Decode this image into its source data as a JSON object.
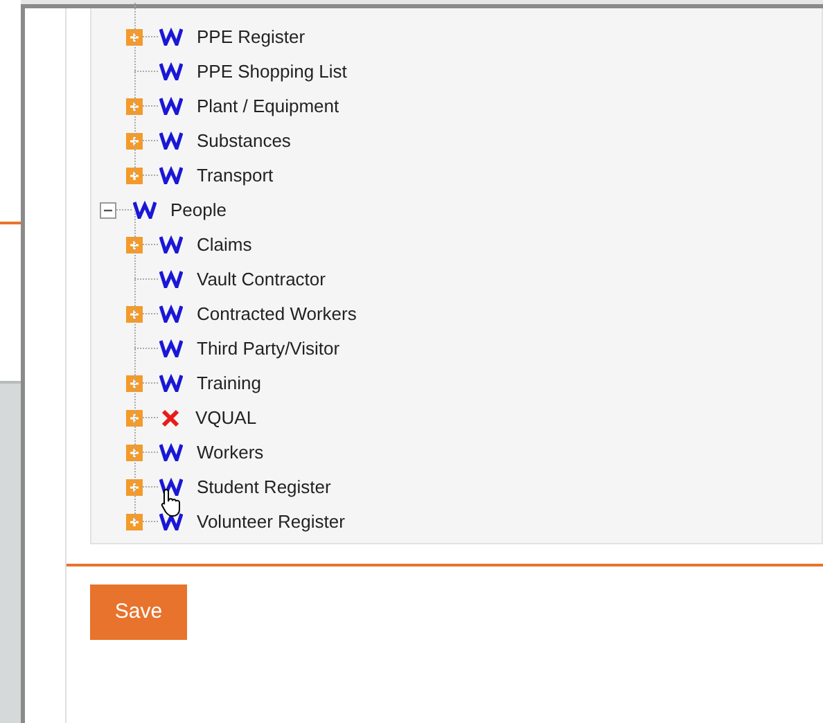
{
  "tree": [
    {
      "children": [
        {
          "label": "PPE Register",
          "kind": "collapsed",
          "error": false
        },
        {
          "label": "PPE Shopping List",
          "kind": "leaf",
          "error": false
        },
        {
          "label": "Plant / Equipment",
          "kind": "collapsed",
          "error": false
        },
        {
          "label": "Substances",
          "kind": "collapsed",
          "error": false
        },
        {
          "label": "Transport",
          "kind": "collapsed",
          "error": false
        }
      ]
    },
    {
      "label": "People",
      "kind": "expanded",
      "error": false,
      "children": [
        {
          "label": "Claims",
          "kind": "collapsed",
          "error": false
        },
        {
          "label": "Vault Contractor",
          "kind": "leaf",
          "error": false
        },
        {
          "label": "Contracted Workers",
          "kind": "collapsed",
          "error": false
        },
        {
          "label": "Third Party/Visitor",
          "kind": "leaf",
          "error": false
        },
        {
          "label": "Training",
          "kind": "collapsed",
          "error": false
        },
        {
          "label": "VQUAL",
          "kind": "collapsed",
          "error": true
        },
        {
          "label": "Workers",
          "kind": "collapsed",
          "error": false
        },
        {
          "label": "Student Register",
          "kind": "collapsed",
          "error": false
        },
        {
          "label": "Volunteer Register",
          "kind": "collapsed",
          "error": false
        }
      ]
    }
  ],
  "save_button": "Save"
}
